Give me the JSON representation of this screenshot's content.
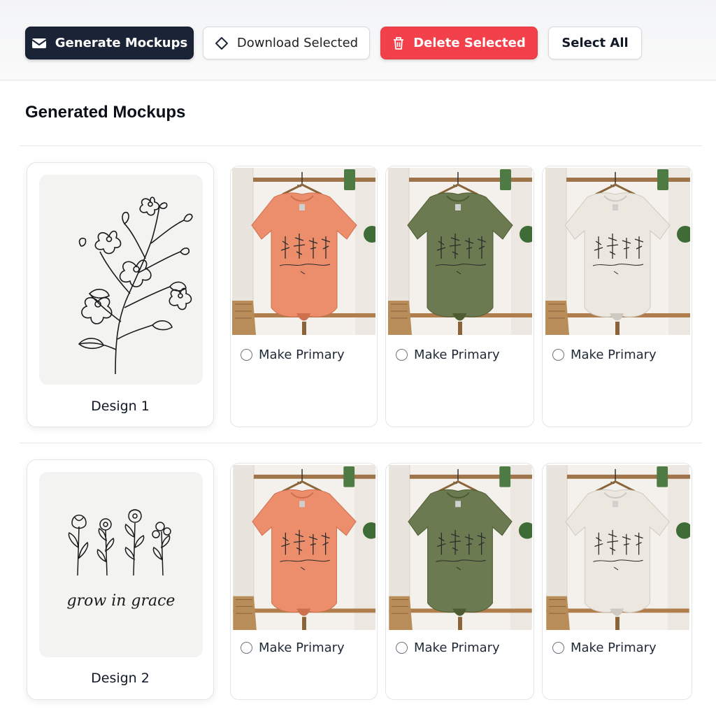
{
  "toolbar": {
    "generate": {
      "label": "Generate Mockups",
      "icon": "envelope-icon"
    },
    "download": {
      "label": "Download Selected",
      "icon": "diamond-icon"
    },
    "delete": {
      "label": "Delete Selected",
      "icon": "trash-icon"
    },
    "select_all": {
      "label": "Select All"
    }
  },
  "section": {
    "title": "Generated Mockups"
  },
  "designs": [
    {
      "label": "Design 1",
      "art": "floral-branch",
      "mockups": [
        {
          "color_name": "coral",
          "color": "#ec8d6c",
          "primary_label": "Make Primary",
          "selected": false
        },
        {
          "color_name": "olive",
          "color": "#6b7a50",
          "primary_label": "Make Primary",
          "selected": false
        },
        {
          "color_name": "cream",
          "color": "#ece8df",
          "primary_label": "Make Primary",
          "selected": false
        }
      ]
    },
    {
      "label": "Design 2",
      "art": "wildflowers",
      "art_text": "grow in grace",
      "mockups": [
        {
          "color_name": "coral",
          "color": "#ec8d6c",
          "primary_label": "Make Primary",
          "selected": false
        },
        {
          "color_name": "olive",
          "color": "#6b7a50",
          "primary_label": "Make Primary",
          "selected": false
        },
        {
          "color_name": "cream",
          "color": "#ece8df",
          "primary_label": "Make Primary",
          "selected": false
        }
      ]
    }
  ],
  "colors": {
    "primary_button": "#1b2436",
    "danger_button": "#f2414a",
    "accent_green": "#4e7a43"
  }
}
